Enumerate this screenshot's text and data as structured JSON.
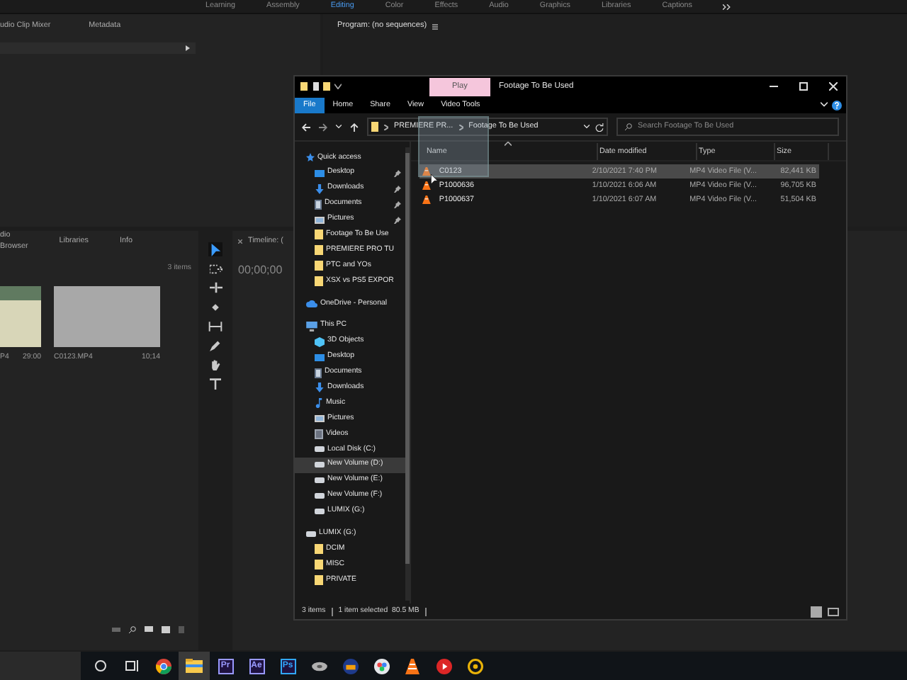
{
  "workspaces": [
    {
      "label": "Learning",
      "selected": false
    },
    {
      "label": "Assembly",
      "selected": false
    },
    {
      "label": "Editing",
      "selected": true
    },
    {
      "label": "Color",
      "selected": false
    },
    {
      "label": "Effects",
      "selected": false
    },
    {
      "label": "Audio",
      "selected": false
    },
    {
      "label": "Graphics",
      "selected": false
    },
    {
      "label": "Libraries",
      "selected": false
    },
    {
      "label": "Captions",
      "selected": false
    }
  ],
  "source_panel": {
    "tabs": [
      "udio Clip Mixer",
      "Metadata"
    ]
  },
  "program_panel": {
    "title": "Program: (no sequences)"
  },
  "project_panel": {
    "tabs": [
      "dio Browser",
      "Libraries",
      "Info"
    ],
    "item_count": "3 items",
    "clips": [
      {
        "name": "P4",
        "duration": "29:00",
        "kind": "house"
      },
      {
        "name": "C0123.MP4",
        "duration": "10;14",
        "kind": "water"
      }
    ]
  },
  "tools": [
    {
      "kind": "select",
      "selected": true
    },
    {
      "kind": "track",
      "selected": false
    },
    {
      "kind": "ripple",
      "selected": false
    },
    {
      "kind": "razor",
      "selected": false
    },
    {
      "kind": "slip",
      "selected": false
    },
    {
      "kind": "pen",
      "selected": false
    },
    {
      "kind": "hand",
      "selected": false
    },
    {
      "kind": "type",
      "selected": false
    }
  ],
  "timeline": {
    "title": "Timeline: (",
    "timecode": "00;00;00"
  },
  "explorer": {
    "title_tab": "Play",
    "title": "Footage To Be Used",
    "ribbon_tabs": [
      {
        "label": "File",
        "kind": "file"
      },
      {
        "label": "Home",
        "kind": "tab"
      },
      {
        "label": "Share",
        "kind": "tab"
      },
      {
        "label": "View",
        "kind": "tab"
      },
      {
        "label": "Video Tools",
        "kind": "tab"
      }
    ],
    "path": [
      "PREMIERE PR...",
      "Footage To Be Used"
    ],
    "search": {
      "placeholder": "Search Footage To Be Used"
    },
    "nav": [
      {
        "label": "Quick access",
        "kind": "star",
        "selected": false,
        "pinned": false,
        "children": [
          {
            "label": "Desktop",
            "kind": "desktop",
            "selected": false,
            "pinned": true
          },
          {
            "label": "Downloads",
            "kind": "download",
            "selected": false,
            "pinned": true
          },
          {
            "label": "Documents",
            "kind": "document",
            "selected": false,
            "pinned": true
          },
          {
            "label": "Pictures",
            "kind": "picture",
            "selected": false,
            "pinned": true
          },
          {
            "label": "Footage To Be Use",
            "kind": "folder",
            "selected": false,
            "pinned": false
          },
          {
            "label": "PREMIERE PRO TU",
            "kind": "folder",
            "selected": false,
            "pinned": false
          },
          {
            "label": "PTC and YOs",
            "kind": "folder",
            "selected": false,
            "pinned": false
          },
          {
            "label": "XSX vs PS5 EXPOR",
            "kind": "folder",
            "selected": false,
            "pinned": false
          }
        ]
      },
      {
        "label": "OneDrive - Personal",
        "kind": "cloud",
        "selected": false,
        "pinned": false
      },
      {
        "label": "This PC",
        "kind": "pc",
        "selected": false,
        "pinned": false,
        "children": [
          {
            "label": "3D Objects",
            "kind": "cube",
            "selected": false,
            "pinned": false
          },
          {
            "label": "Desktop",
            "kind": "desktop",
            "selected": false,
            "pinned": false
          },
          {
            "label": "Documents",
            "kind": "document",
            "selected": false,
            "pinned": false
          },
          {
            "label": "Downloads",
            "kind": "download",
            "selected": false,
            "pinned": false
          },
          {
            "label": "Music",
            "kind": "music",
            "selected": false,
            "pinned": false
          },
          {
            "label": "Pictures",
            "kind": "picture",
            "selected": false,
            "pinned": false
          },
          {
            "label": "Videos",
            "kind": "video",
            "selected": false,
            "pinned": false
          },
          {
            "label": "Local Disk (C:)",
            "kind": "drive",
            "selected": false,
            "pinned": false
          },
          {
            "label": "New Volume (D:)",
            "kind": "drive",
            "selected": true,
            "pinned": false
          },
          {
            "label": "New Volume (E:)",
            "kind": "drive",
            "selected": false,
            "pinned": false
          },
          {
            "label": "New Volume (F:)",
            "kind": "drive",
            "selected": false,
            "pinned": false
          },
          {
            "label": "LUMIX (G:)",
            "kind": "drive",
            "selected": false,
            "pinned": false
          }
        ]
      },
      {
        "label": "LUMIX (G:)",
        "kind": "drive",
        "selected": false,
        "pinned": false,
        "children": [
          {
            "label": "DCIM",
            "kind": "folder",
            "selected": false,
            "pinned": false
          },
          {
            "label": "MISC",
            "kind": "folder",
            "selected": false,
            "pinned": false
          },
          {
            "label": "PRIVATE",
            "kind": "folder",
            "selected": false,
            "pinned": false
          }
        ]
      }
    ],
    "columns": [
      "Name",
      "Date modified",
      "Type",
      "Size"
    ],
    "files": [
      {
        "name": "C0123",
        "date": "2/10/2021 7:40 PM",
        "type": "MP4 Video File (V...",
        "size": "82,441 KB",
        "selected": true
      },
      {
        "name": "P1000636",
        "date": "1/10/2021 6:06 AM",
        "type": "MP4 Video File (V...",
        "size": "96,705 KB",
        "selected": false
      },
      {
        "name": "P1000637",
        "date": "1/10/2021 6:07 AM",
        "type": "MP4 Video File (V...",
        "size": "51,504 KB",
        "selected": false
      }
    ],
    "status": [
      "3 items",
      "1 item selected  80.5 MB"
    ]
  },
  "taskbar": [
    {
      "kind": "search",
      "selected": false
    },
    {
      "kind": "taskview",
      "selected": false
    },
    {
      "kind": "browser",
      "selected": false
    },
    {
      "kind": "explorer",
      "selected": true
    },
    {
      "kind": "app",
      "label": "Pr",
      "color": "#9999ff",
      "selected": false
    },
    {
      "kind": "app",
      "label": "Ae",
      "color": "#9999ff",
      "selected": false
    },
    {
      "kind": "app",
      "label": "Ps",
      "color": "#31a8ff",
      "selected": false
    },
    {
      "kind": "disc",
      "selected": false
    },
    {
      "kind": "game",
      "selected": false
    },
    {
      "kind": "flower",
      "selected": false
    },
    {
      "kind": "cone",
      "selected": false
    },
    {
      "kind": "record",
      "selected": false
    },
    {
      "kind": "smile",
      "selected": false
    }
  ]
}
